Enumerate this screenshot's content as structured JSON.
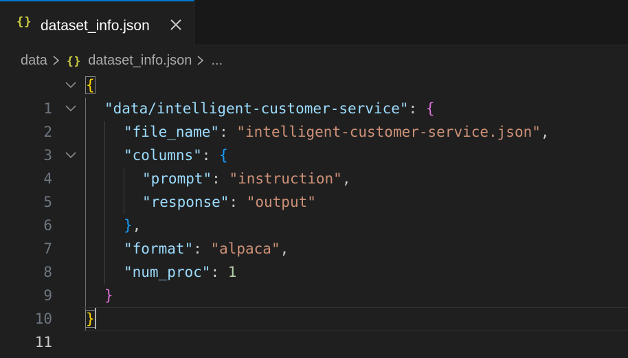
{
  "tab": {
    "icon": "{}",
    "label": "dataset_info.json",
    "close_icon": "close-icon"
  },
  "breadcrumb": {
    "folder": "data",
    "file_icon": "{}",
    "file": "dataset_info.json",
    "more": "..."
  },
  "colors": {
    "accent": "#0078d4",
    "key": "#9cdcfe",
    "string": "#ce9178",
    "number": "#b5cea8",
    "bracket_level1": "#ffd700",
    "bracket_level2": "#da70d6",
    "bracket_level3": "#179fff",
    "json_icon": "#cbcb41"
  },
  "editor": {
    "line_numbers": [
      "1",
      "2",
      "3",
      "4",
      "5",
      "6",
      "7",
      "8",
      "9",
      "10",
      "11"
    ],
    "current_line": "11",
    "tokens": {
      "l1_open": "{",
      "l2_key": "\"data/intelligent-customer-service\"",
      "l2_colon": ": ",
      "l2_open": "{",
      "l3_key": "\"file_name\"",
      "l3_colon": ": ",
      "l3_val": "\"intelligent-customer-service.json\"",
      "l3_comma": ",",
      "l4_key": "\"columns\"",
      "l4_colon": ": ",
      "l4_open": "{",
      "l5_key": "\"prompt\"",
      "l5_colon": ": ",
      "l5_val": "\"instruction\"",
      "l5_comma": ",",
      "l6_key": "\"response\"",
      "l6_colon": ": ",
      "l6_val": "\"output\"",
      "l7_close": "}",
      "l7_comma": ",",
      "l8_key": "\"format\"",
      "l8_colon": ": ",
      "l8_val": "\"alpaca\"",
      "l8_comma": ",",
      "l9_key": "\"num_proc\"",
      "l9_colon": ": ",
      "l9_val": "1",
      "l10_close": "}",
      "l11_close": "}"
    }
  }
}
